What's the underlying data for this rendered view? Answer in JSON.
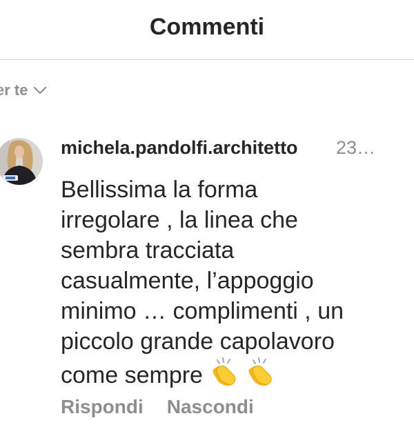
{
  "header": {
    "title": "Commenti"
  },
  "filter": {
    "label": "er te",
    "icon": "chevron-down-icon"
  },
  "comment": {
    "username": "michela.pandolfi.architetto",
    "time": "23…",
    "text_lines": [
      "Bellissima la forma",
      "irregolare , la linea che",
      "sembra tracciata",
      "casualmente, l’appoggio",
      "minimo … complimenti , un",
      "piccolo grande capolavoro",
      "come sempre"
    ],
    "emoji": "clapping-hands-icon",
    "actions": {
      "reply_label": "Rispondi",
      "hide_label": "Nascondi"
    }
  },
  "colors": {
    "text_primary": "#262626",
    "text_secondary": "#8e8e8e",
    "divider": "#dbdbdb",
    "clap_yellow": "#f7c22b"
  }
}
